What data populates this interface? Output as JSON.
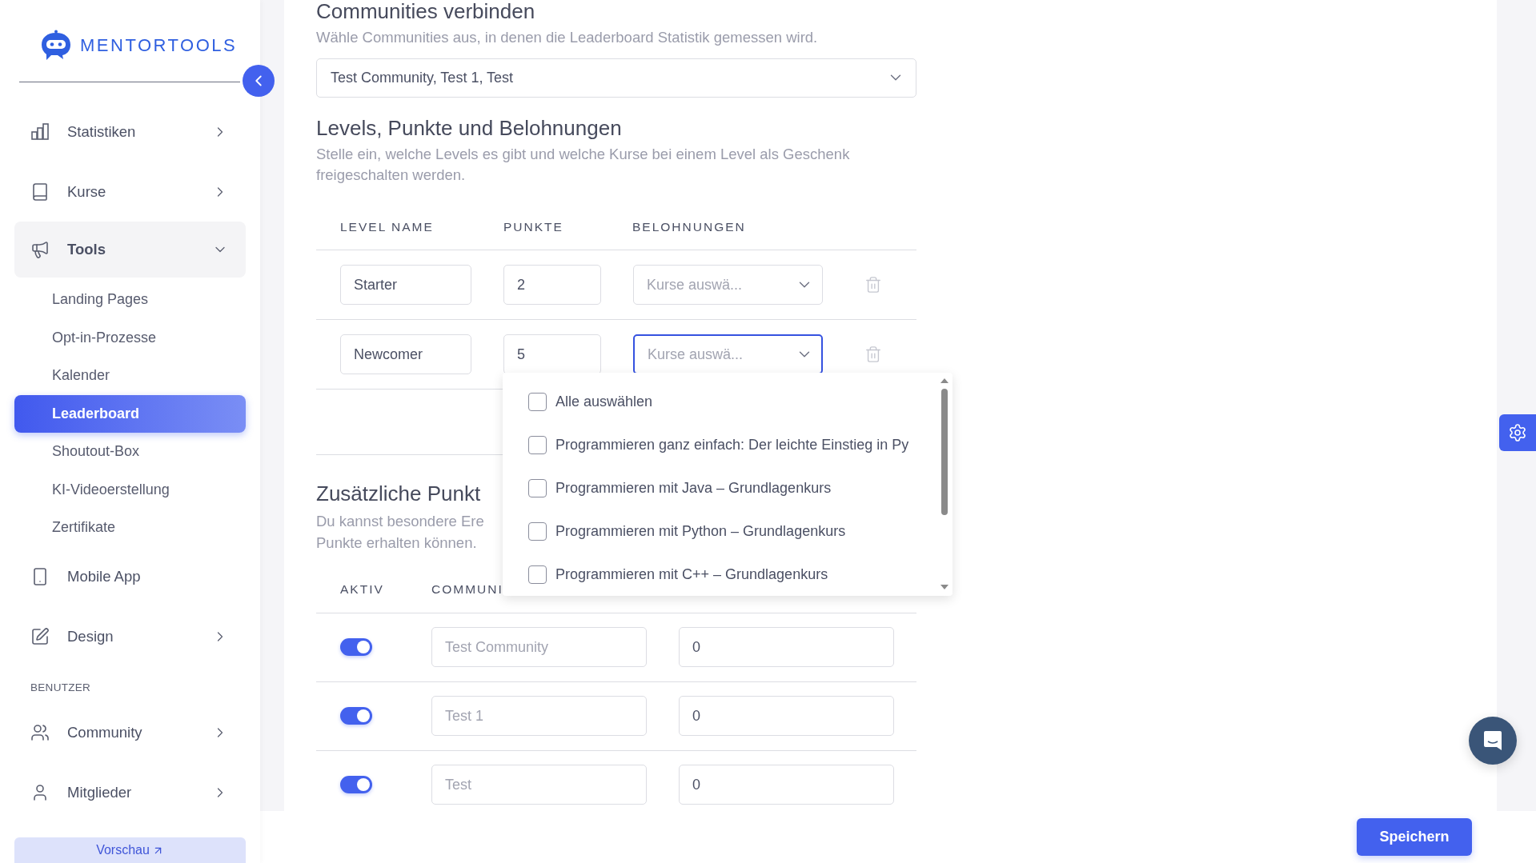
{
  "sidebar": {
    "logo": "MENTORTOOLS",
    "nav": [
      {
        "kind": "group",
        "label": "Statistiken",
        "expanded": false
      },
      {
        "kind": "group",
        "label": "Kurse",
        "expanded": false
      },
      {
        "kind": "group",
        "label": "Tools",
        "expanded": true,
        "children": [
          {
            "label": "Landing Pages",
            "selected": false
          },
          {
            "label": "Opt-in-Prozesse",
            "selected": false
          },
          {
            "label": "Kalender",
            "selected": false
          },
          {
            "label": "Leaderboard",
            "selected": true
          },
          {
            "label": "Shoutout-Box",
            "selected": false
          },
          {
            "label": "KI-Videoerstellung",
            "selected": false
          },
          {
            "label": "Zertifikate",
            "selected": false
          }
        ]
      },
      {
        "kind": "link",
        "label": "Mobile App"
      },
      {
        "kind": "group",
        "label": "Design",
        "expanded": false
      },
      {
        "kind": "section",
        "label": "BENUTZER"
      },
      {
        "kind": "group",
        "label": "Community",
        "expanded": false
      },
      {
        "kind": "group",
        "label": "Mitglieder",
        "expanded": false
      }
    ],
    "preview_button": "Vorschau"
  },
  "communities": {
    "title": "Communities verbinden",
    "description": "Wähle Communities aus, in denen die Leaderboard Statistik gemessen wird.",
    "select": {
      "value": "Test Community, Test 1, Test"
    }
  },
  "levels": {
    "title": "Levels, Punkte und Belohnungen",
    "description": "Stelle ein, welche Levels es gibt und welche Kurse bei einem Level als Geschenk freigeschalten werden.",
    "columns": [
      "LEVEL NAME",
      "PUNKTE",
      "BELOHNUNGEN"
    ],
    "rows": [
      {
        "name": "Starter",
        "points": "2",
        "rewards": {
          "placeholder": "Kurse auswä...",
          "focused": false
        }
      },
      {
        "name": "Newcomer",
        "points": "5",
        "rewards": {
          "placeholder": "Kurse auswä...",
          "focused": true
        }
      }
    ]
  },
  "dropdown": {
    "options": [
      {
        "label": "Alle auswählen",
        "checked": false
      },
      {
        "label": "Programmieren ganz einfach: Der leichte Einstieg in Py",
        "checked": false
      },
      {
        "label": "Programmieren mit Java – Grundlagenkurs",
        "checked": false
      },
      {
        "label": "Programmieren mit Python – Grundlagenkurs",
        "checked": false
      },
      {
        "label": "Programmieren mit C++ – Grundlagenkurs",
        "checked": false
      }
    ]
  },
  "extra": {
    "title": "Zusätzliche Punkt",
    "description_lines": [
      "Du kannst besondere Ere",
      "Punkte erhalten können."
    ],
    "columns": [
      "AKTIV",
      "COMMUNI"
    ],
    "rows": [
      {
        "on": true,
        "community": "Test Community",
        "points": "0"
      },
      {
        "on": true,
        "community": "Test 1",
        "points": "0"
      },
      {
        "on": true,
        "community": "Test",
        "points": "0"
      }
    ]
  },
  "save_button": "Speichern"
}
